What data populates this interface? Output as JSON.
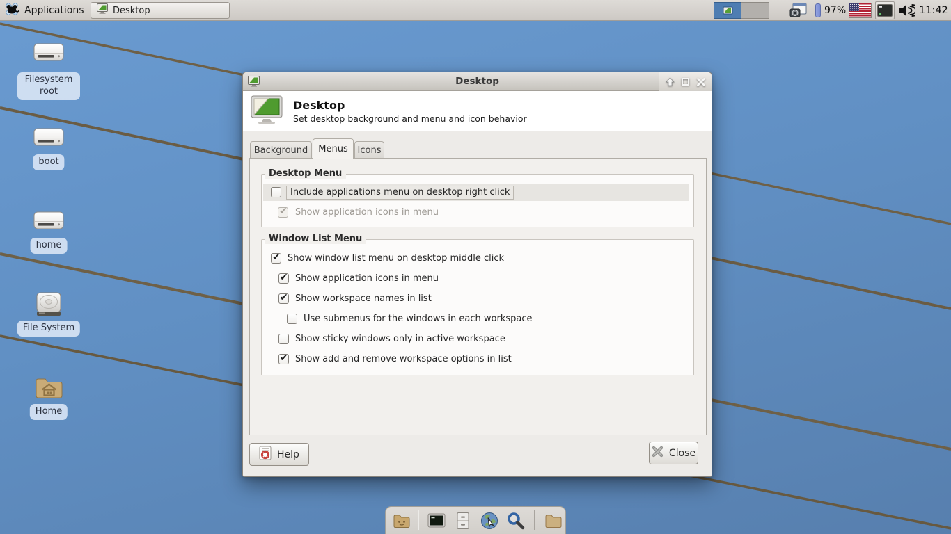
{
  "panel": {
    "applications_label": "Applications",
    "taskbar_item_label": "Desktop",
    "battery_percent": "97%",
    "clock": "11:42"
  },
  "desktop_icons": {
    "filesystem_root": "Filesystem root",
    "boot": "boot",
    "home_partition": "home",
    "file_system": "File System",
    "home_folder": "Home"
  },
  "window": {
    "title": "Desktop",
    "header": {
      "title": "Desktop",
      "subtitle": "Set desktop background and menu and icon behavior"
    },
    "tabs": {
      "background": "Background",
      "menus": "Menus",
      "icons": "Icons"
    },
    "desktop_menu": {
      "legend": "Desktop Menu",
      "items": [
        {
          "label": "Include applications menu on desktop right click",
          "checked": false,
          "disabled": false
        },
        {
          "label": "Show application icons in menu",
          "checked": true,
          "disabled": true
        }
      ]
    },
    "window_list_menu": {
      "legend": "Window List Menu",
      "items": [
        {
          "label": "Show window list menu on desktop middle click",
          "checked": true
        },
        {
          "label": "Show application icons in menu",
          "checked": true
        },
        {
          "label": "Show workspace names in list",
          "checked": true
        },
        {
          "label": "Use submenus for the windows in each workspace",
          "checked": false
        },
        {
          "label": "Show sticky windows only in active workspace",
          "checked": false
        },
        {
          "label": "Show add and remove workspace options in list",
          "checked": true
        }
      ]
    },
    "buttons": {
      "help": "Help",
      "close": "Close"
    }
  },
  "colors": {
    "sky_top": "#6a9bd1",
    "sky_bottom": "#577fae",
    "wire": "#6e6047",
    "panel_bg": "#d6d3ce",
    "active_workspace": "#4e7db2",
    "selection_label_bg": "#dde7f6",
    "accent_green_screen": "#4f9b2f"
  }
}
